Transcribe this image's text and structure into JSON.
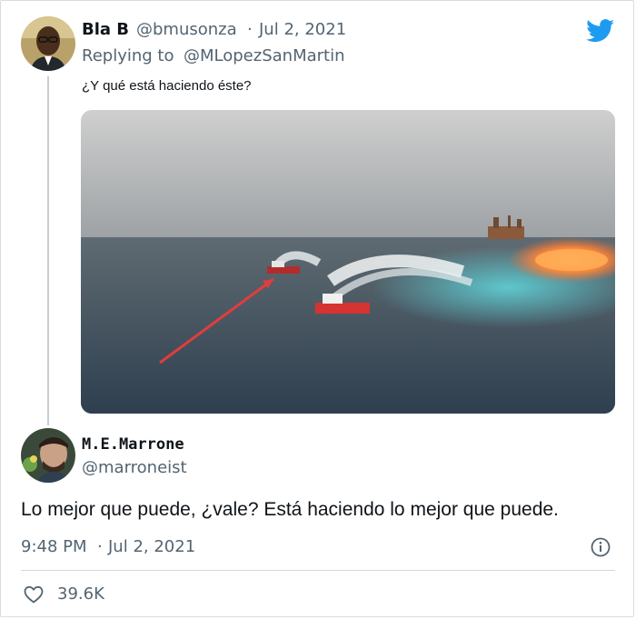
{
  "tweet1": {
    "name": "Bla B",
    "handle": "@bmusonza",
    "separator": "·",
    "date": "Jul 2, 2021",
    "reply_prefix": "Replying to",
    "reply_to": "@MLopezSanMartin",
    "text": "¿Y qué está haciendo éste?",
    "avatar_icon": "avatar-man-glasses",
    "media_icon": "photo-oil-platform-fire-with-boats"
  },
  "tweet2": {
    "name": "M.E.Marrone",
    "handle": "@marroneist",
    "text": "Lo mejor que puede, ¿vale? Está haciendo lo mejor que puede.",
    "time": "9:48 PM",
    "separator": "·",
    "date": "Jul 2, 2021",
    "likes": "39.6K",
    "avatar_icon": "avatar-man-beard"
  },
  "colors": {
    "twitter_blue": "#1d9bf0",
    "secondary_text": "#536471",
    "primary_text": "#0f1419",
    "thread_line": "#c4cfd6"
  },
  "icons": {
    "logo": "twitter-bird-icon",
    "info": "info-icon",
    "like": "heart-icon"
  }
}
